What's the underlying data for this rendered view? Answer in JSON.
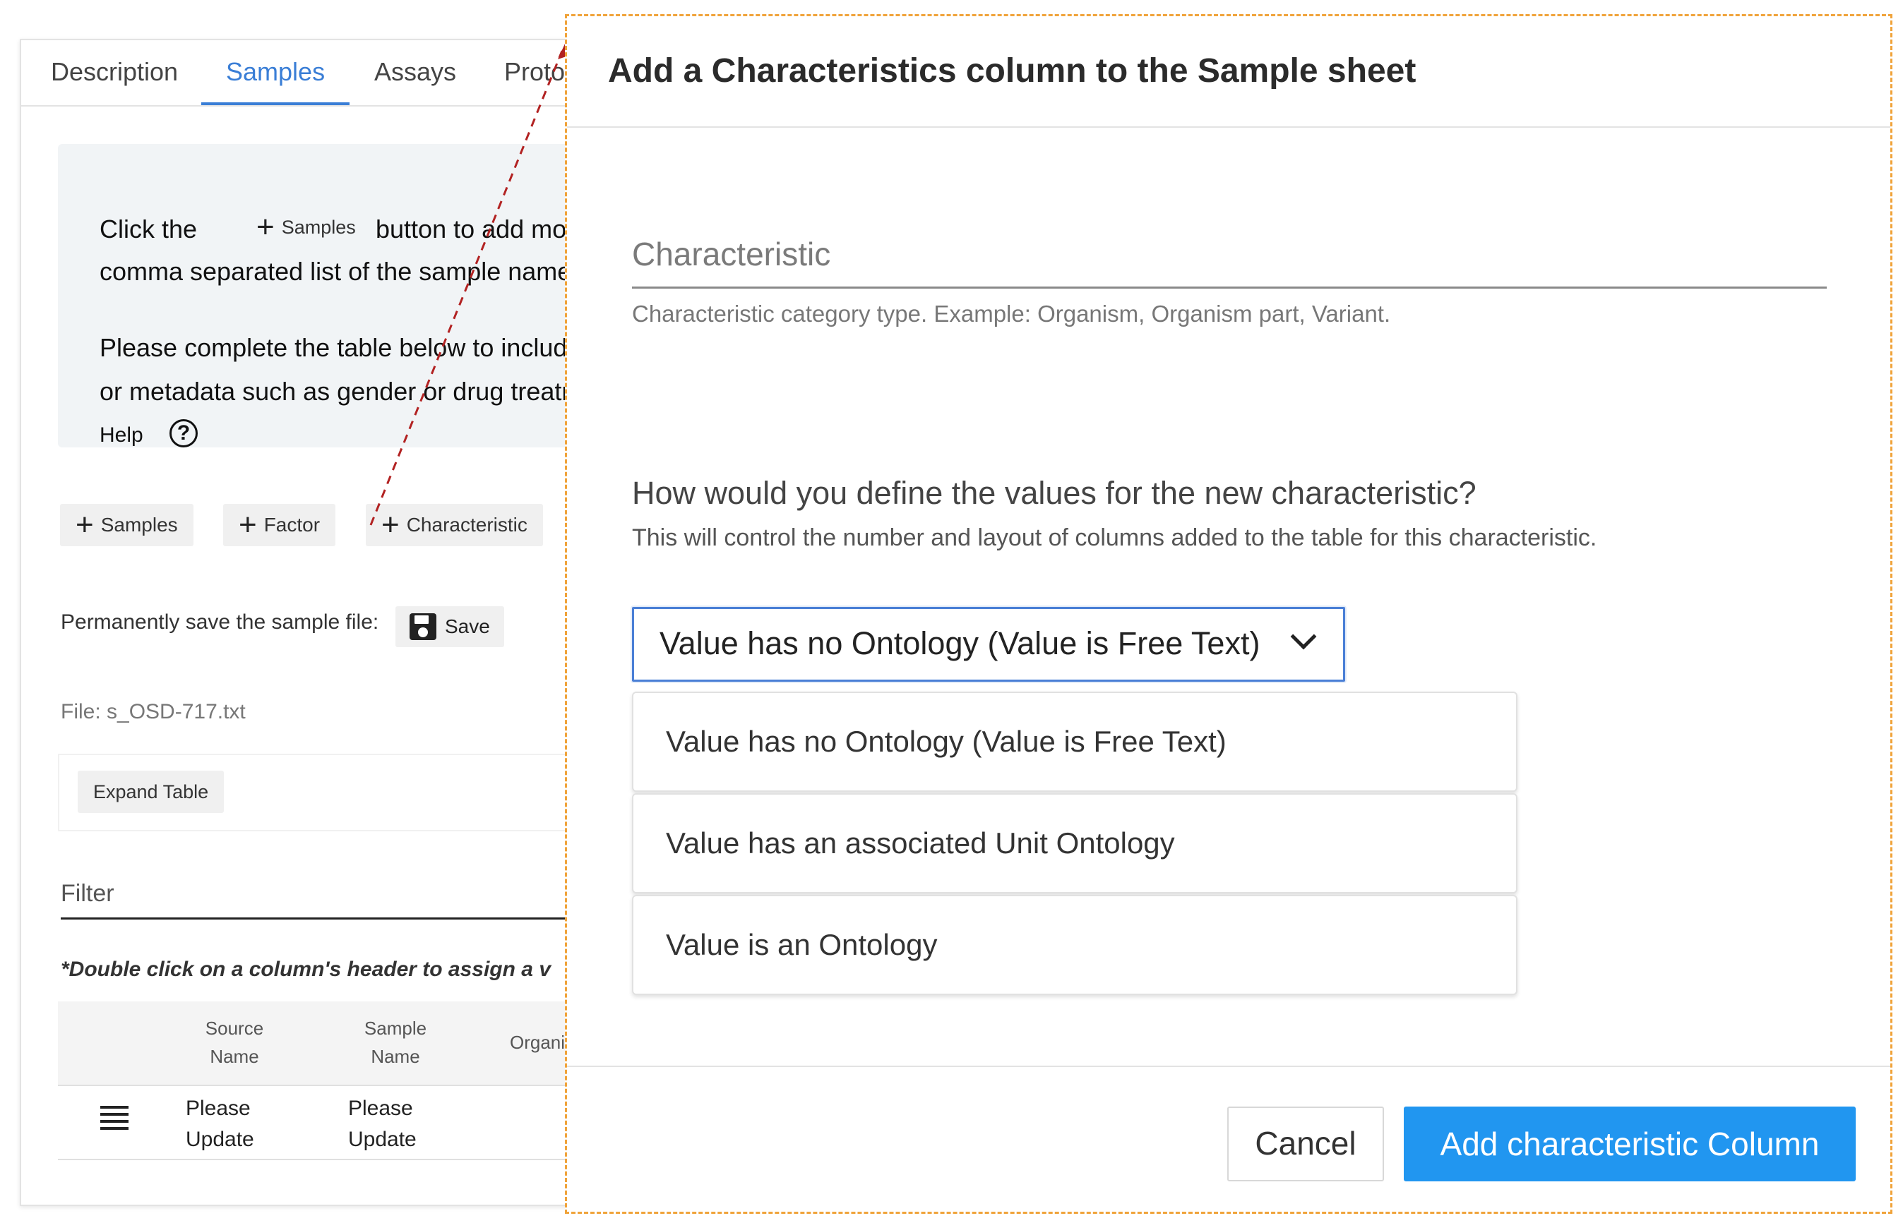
{
  "background_page": {
    "tabs": [
      "Description",
      "Samples",
      "Assays",
      "Proto"
    ],
    "info": {
      "line1_before": "Click the",
      "line1_after": "button to add more",
      "samples_inline_label": "Samples",
      "line2": "comma separated list of the sample name",
      "line3": "Please complete the table below to includ",
      "line4": "or metadata such as gender or drug treatr",
      "help_label": "Help",
      "help_glyph": "?"
    },
    "toolbar": {
      "samples_label": "Samples",
      "factor_label": "Factor",
      "characteristic_label": "Characteristic"
    },
    "save": {
      "prompt": "Permanently save the sample file:",
      "button_label": "Save"
    },
    "file_label": "File: s_OSD-717.txt",
    "expand_label": "Expand Table",
    "filter_label": "Filter",
    "hint": "*Double click on a column's header to assign a v",
    "table": {
      "headers": [
        {
          "line1": "Source",
          "line2": "Name"
        },
        {
          "line1": "Sample",
          "line2": "Name"
        },
        {
          "line1": "Organi",
          "line2": ""
        }
      ],
      "row": [
        {
          "line1": "Please",
          "line2": "Update"
        },
        {
          "line1": "Please",
          "line2": "Update"
        }
      ]
    }
  },
  "modal": {
    "title": "Add a Characteristics column to the Sample sheet",
    "field_label": "Characteristic",
    "field_help": "Characteristic category type. Example: Organism, Organism part, Variant.",
    "question": "How would you define the values for the new characteristic?",
    "question_help": "This will control the number and layout of columns added to the table for this characteristic.",
    "selected_value": "Value has no Ontology (Value is Free Text)",
    "options": [
      "Value has no Ontology (Value is Free Text)",
      "Value has an associated Unit Ontology",
      "Value is an Ontology"
    ],
    "cancel_label": "Cancel",
    "add_label": "Add characteristic Column"
  },
  "colors": {
    "accent": "#3a7ed6",
    "primary_button": "#2196f0",
    "callout_border": "#f0a33a",
    "arrow": "#b22222"
  }
}
